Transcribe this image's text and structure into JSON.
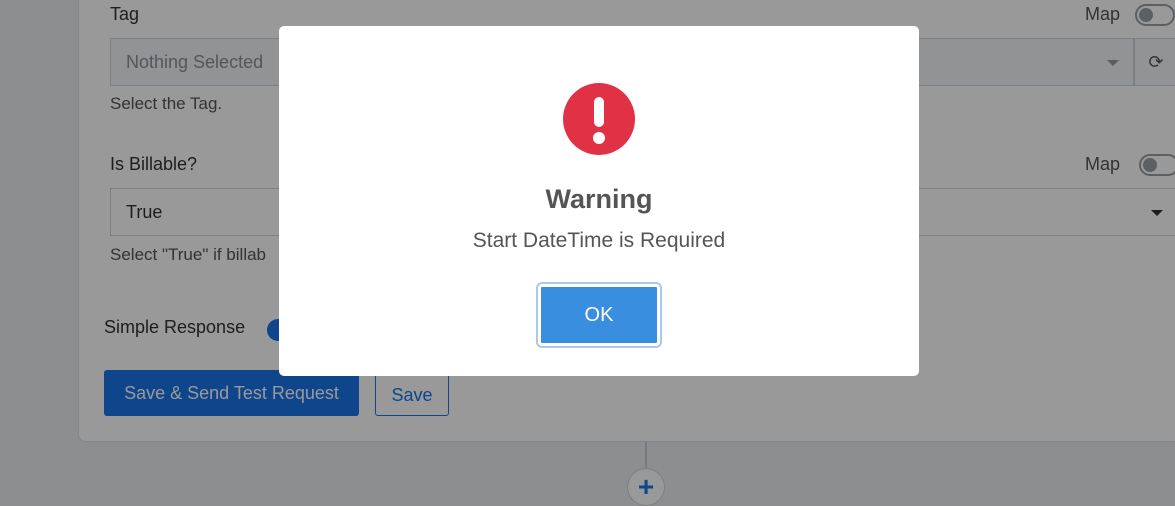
{
  "form": {
    "tag": {
      "label": "Tag",
      "map_label": "Map",
      "select_value": "Nothing Selected",
      "help": "Select the Tag."
    },
    "billable": {
      "label": "Is Billable?",
      "map_label": "Map",
      "select_value": "True",
      "help": "Select \"True\" if billab"
    },
    "simple_response": {
      "label": "Simple Response"
    },
    "buttons": {
      "save_send": "Save & Send Test Request",
      "save": "Save"
    },
    "add_step_symbol": "+"
  },
  "modal": {
    "icon": "exclamation-icon",
    "title": "Warning",
    "message": "Start DateTime is Required",
    "ok_label": "OK"
  },
  "colors": {
    "primary": "#1a73e8",
    "warning": "#e03244",
    "ok_button": "#3a8ee0"
  }
}
